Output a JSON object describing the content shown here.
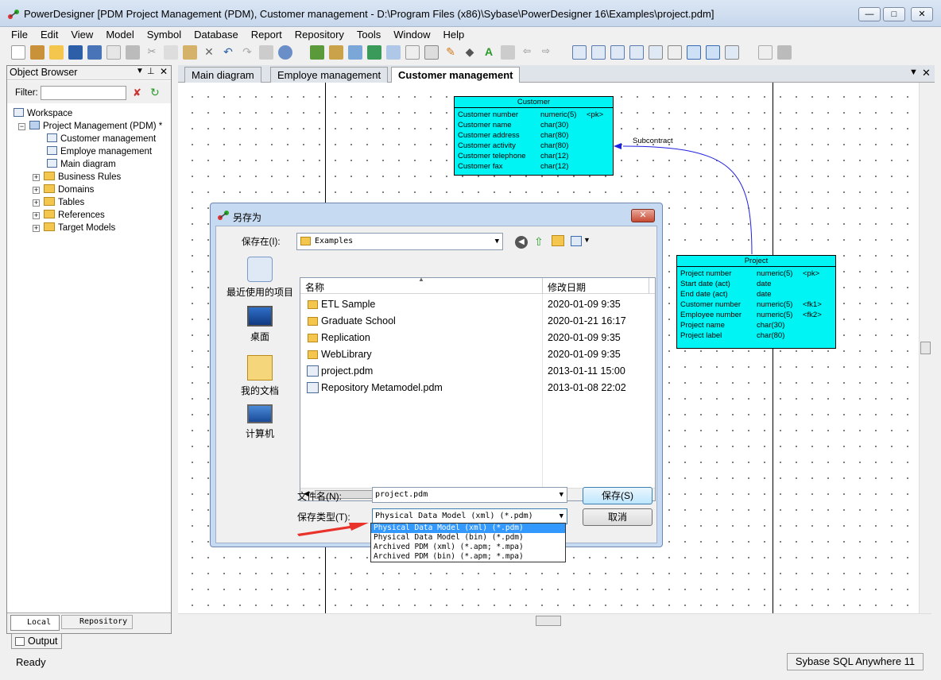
{
  "window": {
    "title": "PowerDesigner [PDM Project Management (PDM), Customer management - D:\\Program Files (x86)\\Sybase\\PowerDesigner 16\\Examples\\project.pdm]",
    "min": "—",
    "max": "□",
    "close": "✕"
  },
  "menu": [
    "File",
    "Edit",
    "View",
    "Model",
    "Symbol",
    "Database",
    "Report",
    "Repository",
    "Tools",
    "Window",
    "Help"
  ],
  "browser": {
    "title": "Object Browser",
    "filter_label": "Filter:",
    "tree": {
      "workspace": "Workspace",
      "project": "Project Management (PDM) *",
      "diagrams": [
        "Customer management",
        "Employe management",
        "Main diagram"
      ],
      "folders": [
        "Business Rules",
        "Domains",
        "Tables",
        "References",
        "Target Models"
      ]
    },
    "tabs": [
      "Local",
      "Repository"
    ]
  },
  "diagram_tabs": [
    "Main diagram",
    "Employe management",
    "Customer management"
  ],
  "entities": {
    "customer": {
      "name": "Customer",
      "rows": [
        [
          "Customer number",
          "numeric(5)",
          "<pk>"
        ],
        [
          "Customer name",
          "char(30)",
          ""
        ],
        [
          "Customer address",
          "char(80)",
          ""
        ],
        [
          "Customer activity",
          "char(80)",
          ""
        ],
        [
          "Customer telephone",
          "char(12)",
          ""
        ],
        [
          "Customer fax",
          "char(12)",
          ""
        ]
      ]
    },
    "project": {
      "name": "Project",
      "rows": [
        [
          "Project number",
          "numeric(5)",
          "<pk>"
        ],
        [
          "Start date (act)",
          "date",
          ""
        ],
        [
          "End date (act)",
          "date",
          ""
        ],
        [
          "Customer number",
          "numeric(5)",
          "<fk1>"
        ],
        [
          "Employee number",
          "numeric(5)",
          "<fk2>"
        ],
        [
          "Project name",
          "char(30)",
          ""
        ],
        [
          "Project label",
          "char(80)",
          ""
        ]
      ]
    },
    "relation": "Subcontract"
  },
  "dialog": {
    "title": "另存为",
    "save_in_label": "保存在(I):",
    "save_in_value": "Examples",
    "places": [
      "最近使用的项目",
      "桌面",
      "我的文档",
      "计算机"
    ],
    "columns": {
      "name": "名称",
      "date": "修改日期"
    },
    "files": [
      {
        "name": "ETL Sample",
        "date": "2020-01-09 9:35",
        "type": "folder"
      },
      {
        "name": "Graduate School",
        "date": "2020-01-21 16:17",
        "type": "folder"
      },
      {
        "name": "Replication",
        "date": "2020-01-09 9:35",
        "type": "folder"
      },
      {
        "name": "WebLibrary",
        "date": "2020-01-09 9:35",
        "type": "folder"
      },
      {
        "name": "project.pdm",
        "date": "2013-01-11 15:00",
        "type": "file"
      },
      {
        "name": "Repository Metamodel.pdm",
        "date": "2013-01-08 22:02",
        "type": "file"
      }
    ],
    "filename_label": "文件名(N):",
    "filename_value": "project.pdm",
    "filetype_label": "保存类型(T):",
    "filetype_value": "Physical Data Model (xml) (*.pdm)",
    "save_button": "保存(S)",
    "cancel_button": "取消",
    "filetype_options": [
      "Physical Data Model (xml) (*.pdm)",
      "Physical Data Model (bin) (*.pdm)",
      "Archived PDM (xml) (*.apm; *.mpa)",
      "Archived PDM (bin) (*.apm; *.mpa)"
    ]
  },
  "output_tab": "Output",
  "status": {
    "left": "Ready",
    "right": "Sybase SQL Anywhere 11"
  }
}
